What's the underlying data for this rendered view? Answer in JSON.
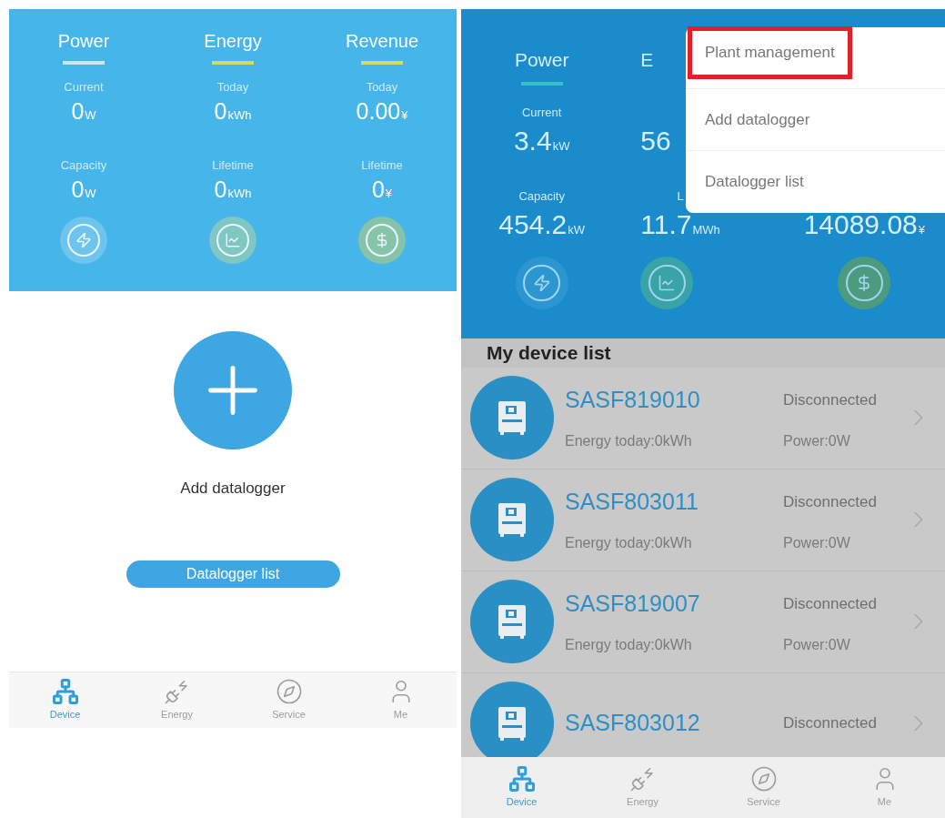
{
  "left_screen": {
    "dimmed": false,
    "stats": [
      {
        "kind": "power",
        "title": "Power",
        "color": "#cbe7f6",
        "items": [
          {
            "label": "Current",
            "value": "0",
            "unit": "W"
          },
          {
            "label": "Capacity",
            "value": "0",
            "unit": "W"
          }
        ]
      },
      {
        "kind": "energy",
        "title": "Energy",
        "color": "#cfdc6c",
        "items": [
          {
            "label": "Today",
            "value": "0",
            "unit": "kWh"
          },
          {
            "label": "Lifetime",
            "value": "0",
            "unit": "kWh"
          }
        ]
      },
      {
        "kind": "revenue",
        "title": "Revenue",
        "color": "#cfdc6c",
        "items": [
          {
            "label": "Today",
            "value": "0.00",
            "unit": "¥"
          },
          {
            "label": "Lifetime",
            "value": "0",
            "unit": "¥"
          }
        ]
      }
    ],
    "add_label": "Add datalogger",
    "list_button": "Datalogger list",
    "tabs": [
      {
        "kind": "device",
        "label": "Device",
        "selected": true
      },
      {
        "kind": "energy",
        "label": "Energy",
        "selected": false
      },
      {
        "kind": "service",
        "label": "Service",
        "selected": false
      },
      {
        "kind": "me",
        "label": "Me",
        "selected": false
      }
    ]
  },
  "right_screen": {
    "dimmed": true,
    "stats": [
      {
        "kind": "power",
        "title": "Power",
        "color": "#36c0c6",
        "items": [
          {
            "label": "Current",
            "value": "3.4",
            "unit": "kW"
          },
          {
            "label": "Capacity",
            "value": "454.2",
            "unit": "kW"
          }
        ]
      },
      {
        "kind": "energy",
        "title": "E",
        "items": [
          {
            "value": "56"
          },
          {
            "label": "L",
            "value": "11.7",
            "unit": "MWh"
          }
        ]
      },
      {
        "kind": "revenue",
        "items": [
          {
            "value": "14089.08",
            "unit": "¥"
          }
        ]
      }
    ],
    "menu": [
      {
        "label": "Plant management",
        "highlighted": true
      },
      {
        "label": "Add datalogger",
        "highlighted": false
      },
      {
        "label": "Datalogger list",
        "highlighted": false
      }
    ],
    "section_title": "My device list",
    "devices": [
      {
        "name": "SASF819010",
        "status": "Disconnected",
        "energy": "Energy today:0kWh",
        "power": "Power:0W"
      },
      {
        "name": "SASF803011",
        "status": "Disconnected",
        "energy": "Energy today:0kWh",
        "power": "Power:0W"
      },
      {
        "name": "SASF819007",
        "status": "Disconnected",
        "energy": "Energy today:0kWh",
        "power": "Power:0W"
      },
      {
        "name": "SASF803012",
        "status": "Disconnected"
      }
    ],
    "tabs": [
      {
        "kind": "device",
        "label": "Device",
        "selected": true
      },
      {
        "kind": "energy",
        "label": "Energy",
        "selected": false
      },
      {
        "kind": "service",
        "label": "Service",
        "selected": false
      },
      {
        "kind": "me",
        "label": "Me",
        "selected": false
      }
    ]
  }
}
